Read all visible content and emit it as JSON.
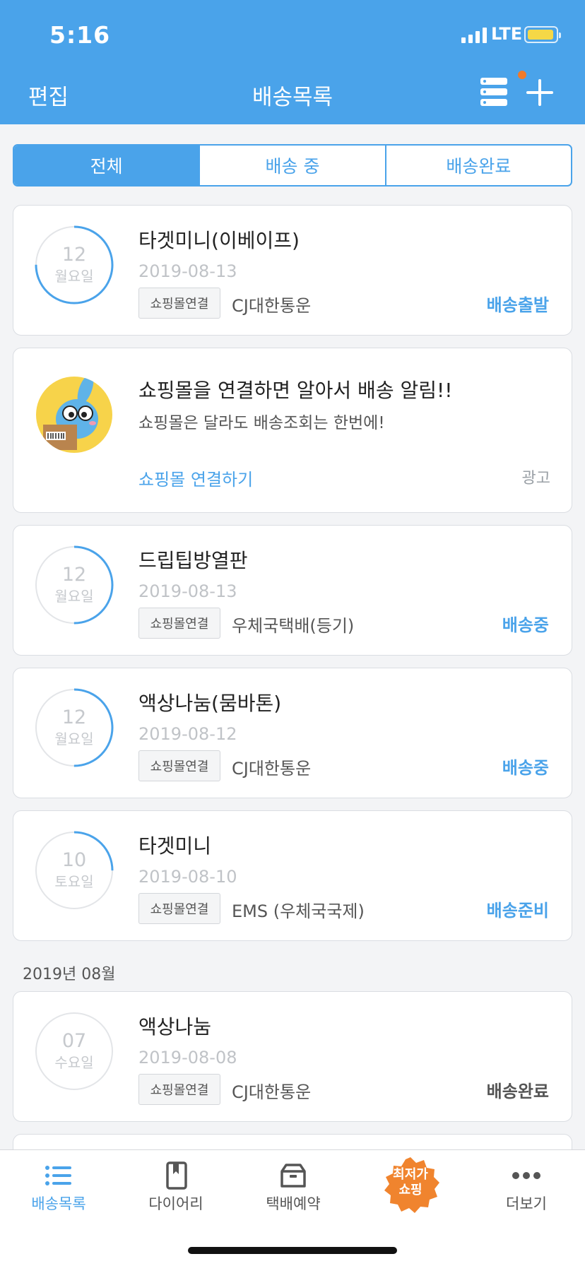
{
  "status_bar": {
    "time": "5:16",
    "network": "LTE"
  },
  "nav": {
    "edit": "편집",
    "title": "배송목록"
  },
  "tabs": [
    "전체",
    "배송 중",
    "배송완료"
  ],
  "chip_label": "쇼핑몰연결",
  "shipments_top": [
    {
      "day": "12",
      "weekday": "월요일",
      "name": "타겟미니(이베이프)",
      "date": "2019-08-13",
      "courier": "CJ대한통운",
      "status": "배송출발",
      "progress": 0.75
    },
    {
      "day": "12",
      "weekday": "월요일",
      "name": "드립팁방열판",
      "date": "2019-08-13",
      "courier": "우체국택배(등기)",
      "status": "배송중",
      "progress": 0.5
    },
    {
      "day": "12",
      "weekday": "월요일",
      "name": "액상나눔(뭄바톤)",
      "date": "2019-08-12",
      "courier": "CJ대한통운",
      "status": "배송중",
      "progress": 0.5
    },
    {
      "day": "10",
      "weekday": "토요일",
      "name": "타겟미니",
      "date": "2019-08-10",
      "courier": "EMS (우체국국제)",
      "status": "배송준비",
      "progress": 0.25
    }
  ],
  "ad": {
    "title": "쇼핑몰을 연결하면 알아서 배송 알림!!",
    "subtitle": "쇼핑몰은 달라도 배송조회는 한번에!",
    "link": "쇼핑몰 연결하기",
    "tag": "광고"
  },
  "month_header": "2019년 08월",
  "shipments_month": [
    {
      "day": "07",
      "weekday": "수요일",
      "name": "액상나눔",
      "date": "2019-08-08",
      "courier": "CJ대한통운",
      "status": "배송완료",
      "progress": 0
    }
  ],
  "tabbar": [
    {
      "label": "배송목록",
      "icon": "list-icon"
    },
    {
      "label": "다이어리",
      "icon": "book-icon"
    },
    {
      "label": "택배예약",
      "icon": "box-icon"
    },
    {
      "label": "최저가 쇼핑",
      "icon": "shopping-badge-icon"
    },
    {
      "label": "더보기",
      "icon": "more-icon"
    }
  ],
  "colors": {
    "accent": "#4aa3ea",
    "badge": "#f07a2a",
    "shopping_badge": "#f0842e"
  }
}
